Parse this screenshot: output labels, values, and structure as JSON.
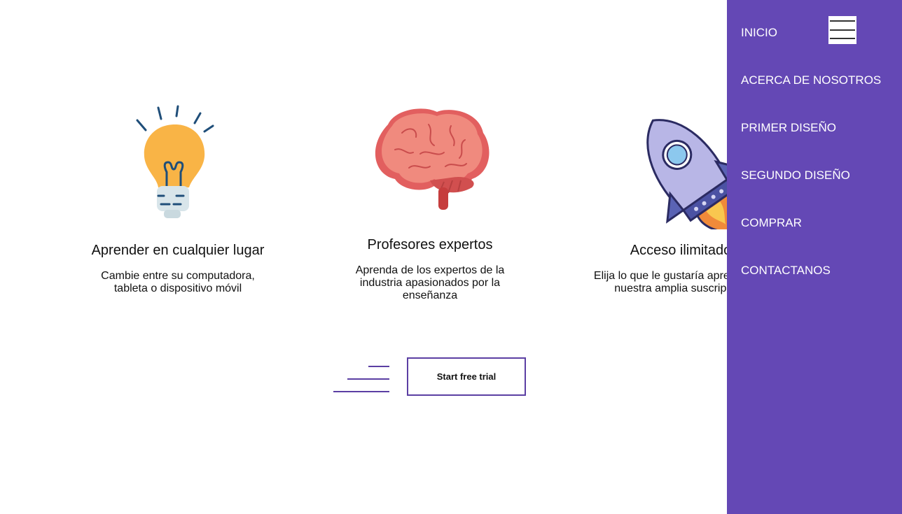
{
  "features": [
    {
      "icon": "lightbulb-icon",
      "title": "Aprender en cualquier lugar",
      "description_lines": [
        "Cambie entre su computadora,",
        "tableta o dispositivo móvil"
      ]
    },
    {
      "icon": "brain-icon",
      "title": "Profesores expertos",
      "description_lines": [
        "Aprenda de los expertos de la",
        "industria apasionados por la",
        "enseñanza"
      ]
    },
    {
      "icon": "rocket-icon",
      "title": "Acceso ilimitado",
      "description_lines": [
        "Elija lo que le gustaría aprender de",
        "nuestra amplia suscripción"
      ]
    }
  ],
  "cta": {
    "label": "Start free trial"
  },
  "nav": {
    "items": [
      "INICIO",
      "ACERCA DE NOSOTROS",
      "PRIMER DISEÑO",
      "SEGUNDO DISEÑO",
      "COMPRAR",
      "CONTACTANOS"
    ]
  },
  "colors": {
    "nav_background": "#6448b5",
    "accent": "#5b3fa3",
    "bulb": "#f9b446",
    "brain": "#f08a7e",
    "rocket": "#b8b6e6"
  }
}
